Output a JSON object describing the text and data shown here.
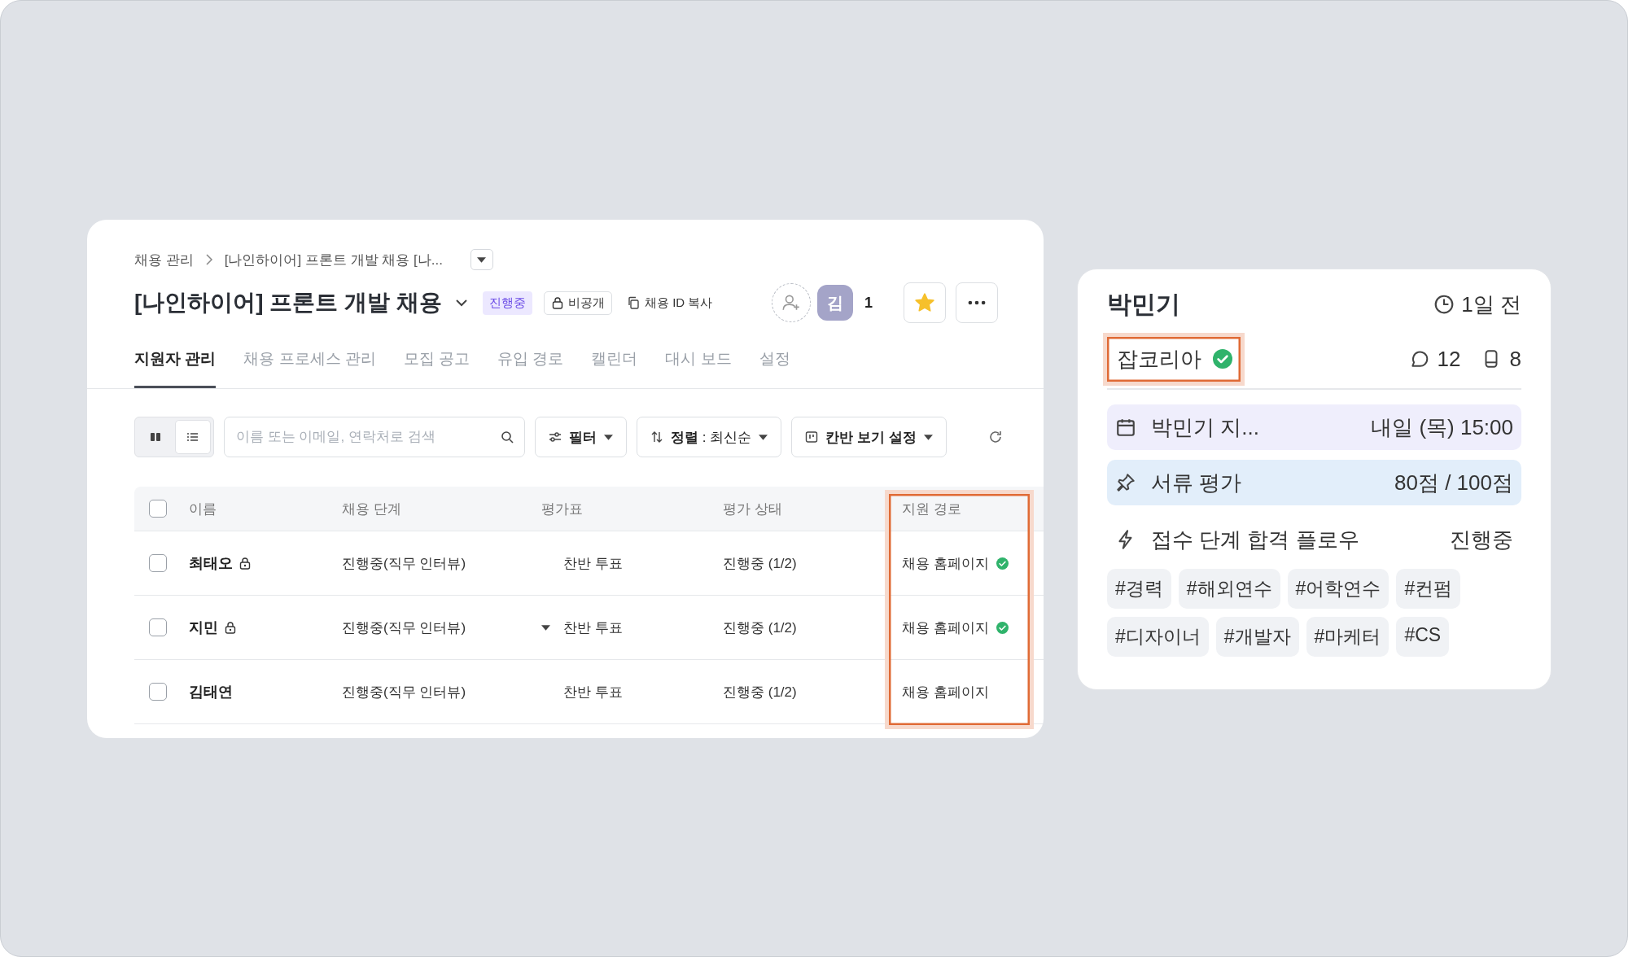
{
  "breadcrumb": [
    "채용 관리",
    "[나인하이어] 프론트 개발 채용 [나..."
  ],
  "header": {
    "title": "[나인하이어] 프론트 개발 채용",
    "status": "진행중",
    "visibility": "비공개",
    "copy_id": "채용 ID 복사",
    "avatar": "김",
    "member_count": "1",
    "starred": true
  },
  "tabs": [
    {
      "label": "지원자 관리",
      "selected": true
    },
    {
      "label": "채용 프로세스 관리",
      "selected": false
    },
    {
      "label": "모집 공고",
      "selected": false
    },
    {
      "label": "유입 경로",
      "selected": false
    },
    {
      "label": "캘린더",
      "selected": false
    },
    {
      "label": "대시 보드",
      "selected": false
    },
    {
      "label": "설정",
      "selected": false
    }
  ],
  "toolbar": {
    "views": [
      {
        "kind": "board",
        "selected": false
      },
      {
        "kind": "list",
        "selected": true
      }
    ],
    "search": {
      "placeholder": "이름 또는 이메일, 연락처로 검색"
    },
    "filter": "필터",
    "sort": "**정렬** : 최신순",
    "kanban": "칸반 보기 설정"
  },
  "table": {
    "all_checked": false,
    "columns": [
      {
        "label": "이름",
        "highlighted": false
      },
      {
        "label": "채용 단계",
        "highlighted": false
      },
      {
        "label": "평가표",
        "highlighted": false
      },
      {
        "label": "평가 상태",
        "highlighted": false
      },
      {
        "label": "지원 경로",
        "highlighted": true
      }
    ],
    "rows": [
      {
        "checked": false,
        "name": "최태오",
        "locked": true,
        "stage": "진행중(직무 인터뷰)",
        "eval": "찬반 투표",
        "eval_caret": false,
        "status": "진행중 (1/2)",
        "source": "채용 홈페이지",
        "verified": true
      },
      {
        "checked": false,
        "name": "지민",
        "locked": true,
        "stage": "진행중(직무 인터뷰)",
        "eval": "찬반 투표",
        "eval_caret": true,
        "status": "진행중 (1/2)",
        "source": "채용 홈페이지",
        "verified": true
      },
      {
        "checked": false,
        "name": "김태연",
        "locked": false,
        "stage": "진행중(직무 인터뷰)",
        "eval": "찬반 투표",
        "eval_caret": false,
        "status": "진행중 (1/2)",
        "source": "채용 홈페이지",
        "verified": false
      }
    ]
  },
  "card": {
    "name": "박민기",
    "time": "1일 전",
    "source": "잡코리아",
    "source_verified": true,
    "source_highlighted": true,
    "comments": "12",
    "devices": "8",
    "items": [
      {
        "kind": "event",
        "label": "박민기 지...",
        "value": "내일 (목) 15:00"
      },
      {
        "kind": "evaluation",
        "label": "서류 평가",
        "value": "80점 / 100점"
      },
      {
        "kind": "flow",
        "label": "접수 단계 합격 플로우",
        "value": "진행중"
      }
    ],
    "tags": [
      "#경력",
      "#해외연수",
      "#어학연수",
      "#컨펌",
      "#디자이너",
      "#개발자",
      "#마케터",
      "#CS"
    ]
  }
}
